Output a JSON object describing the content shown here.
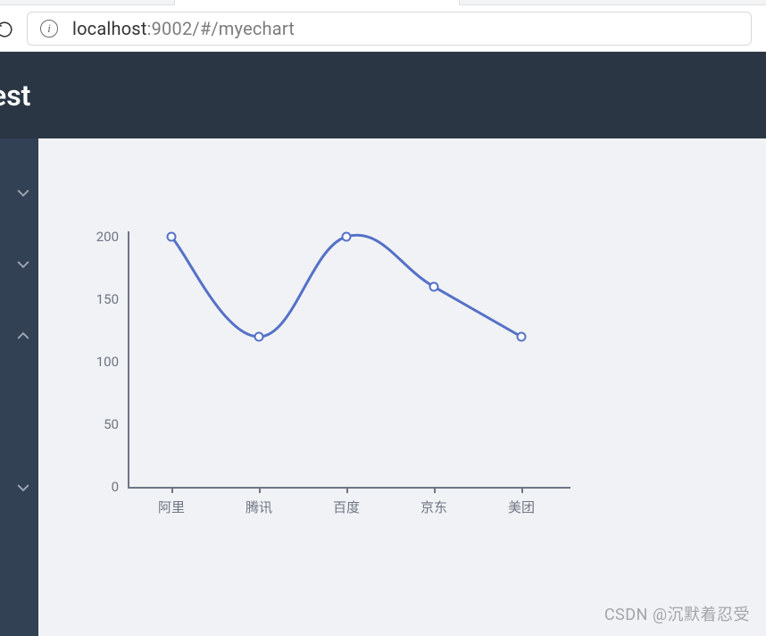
{
  "browser": {
    "url_host": "localhost",
    "url_rest": ":9002/#/myechart"
  },
  "header": {
    "title": "est"
  },
  "sidebar": {
    "items": [
      {
        "arrow": "down"
      },
      {
        "arrow": "down"
      },
      {
        "arrow": "up"
      },
      {
        "arrow": "down"
      }
    ]
  },
  "watermark": "CSDN @沉默着忍受",
  "chart_data": {
    "type": "line",
    "categories": [
      "阿里",
      "腾讯",
      "百度",
      "京东",
      "美团"
    ],
    "values": [
      200,
      120,
      200,
      160,
      120
    ],
    "y_ticks": [
      0,
      50,
      100,
      150,
      200
    ],
    "ylim": [
      0,
      200
    ],
    "smooth": true,
    "line_color": "#5571c7",
    "marker": "hollow-circle"
  }
}
